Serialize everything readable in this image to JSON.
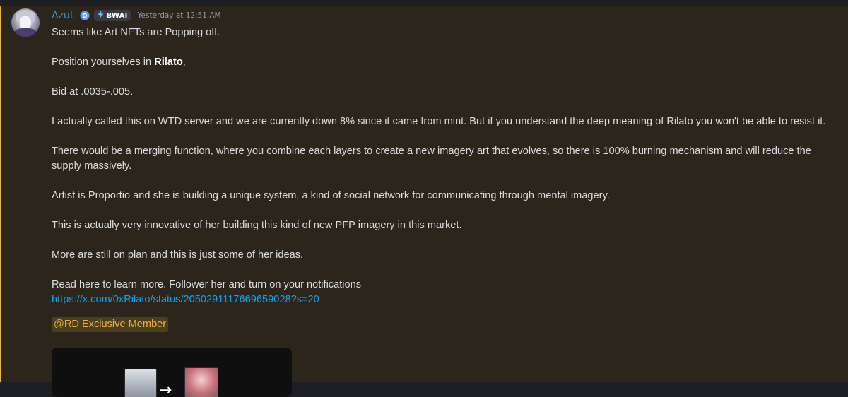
{
  "colors": {
    "username": "#3b8fd6",
    "highlight_border": "#f0b232",
    "message_bg": "#2b251c",
    "link": "#00a8fc",
    "mention_text": "#f0b232"
  },
  "message": {
    "author": "AzuL",
    "verified_icon": "verified-badge-icon",
    "guild_tag": {
      "icon": "lightning-icon",
      "label": "BWAI"
    },
    "timestamp": "Yesterday at 12:51 AM",
    "lines": {
      "l1": "Seems like Art NFTs are Popping off.",
      "l2_prefix": "Position yourselves in ",
      "l2_bold": "Rilato",
      "l2_suffix": ",",
      "l3": "Bid at .0035-.005.",
      "l4": "I actually called this on WTD server and we are currently down 8% since it came from mint. But if you understand the deep meaning of Rilato you won't be able to resist it.",
      "l5": "There would be a merging function, where you combine each layers to create a new imagery art that evolves, so there is 100% burning mechanism and will reduce the supply massively.",
      "l6": "Artist is Proportio and she is building a unique system, a kind of social network for communicating through mental imagery.",
      "l7": "This is actually very innovative of her building this kind of new PFP imagery in this market.",
      "l8": "More are still on plan and this is just some of her ideas.",
      "l9": "Read here to learn more. Follower her and turn on your notifications",
      "link": "https://x.com/0xRilato/status/2050291117669659028?s=20",
      "mention": "@RD Exclusive Member"
    }
  }
}
